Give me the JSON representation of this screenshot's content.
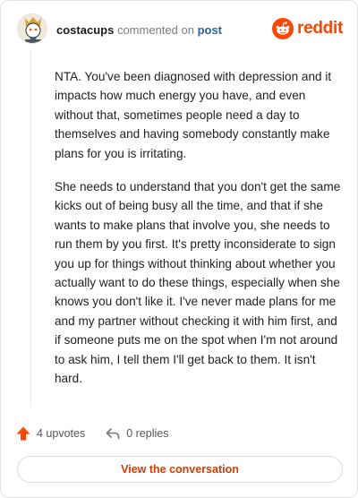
{
  "header": {
    "username": "costacups",
    "action_text": "commented on",
    "target_link": "post",
    "brand_name": "reddit",
    "brand_color": "#ff4500"
  },
  "comment": {
    "paragraphs": [
      "NTA. You've been diagnosed with depression and it impacts how much energy you have, and even without that, sometimes people need a day to themselves and having somebody constantly make plans for you is irritating.",
      "She needs to understand that you don't get the same kicks out of being busy all the time, and that if she wants to make plans that involve you, she needs to run them by you first. It's pretty inconsiderate to sign you up for things without thinking about whether you actually want to do these things, especially when she knows you don't like it. I've never made plans for me and my partner without checking it with him first, and if someone puts me on the spot when I'm not around to ask him, I tell them I'll get back to them. It isn't hard."
    ]
  },
  "actions": {
    "upvotes_label": "4 upvotes",
    "replies_label": "0 replies",
    "upvote_icon": "upvote-arrow-icon",
    "reply_icon": "reply-arrow-icon"
  },
  "cta": {
    "label": "View the conversation",
    "color": "#d93a00"
  }
}
